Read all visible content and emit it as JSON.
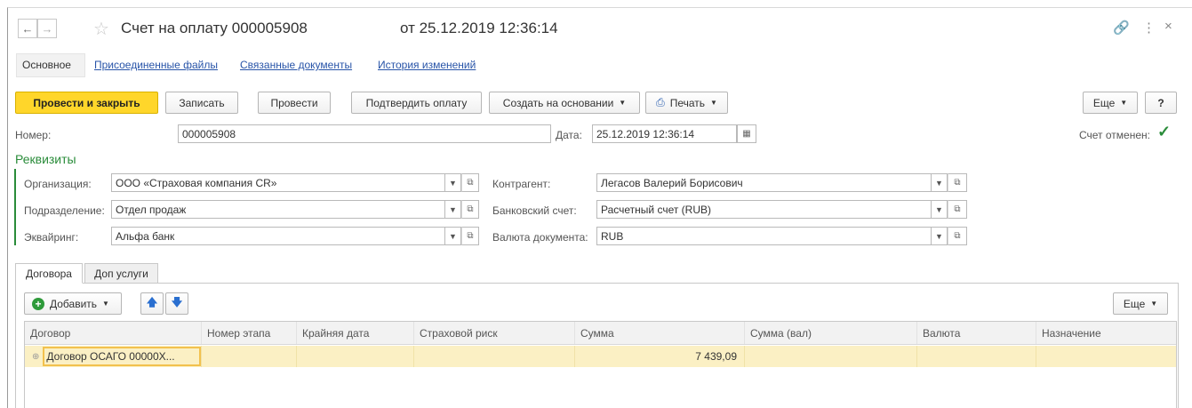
{
  "window": {
    "title": "Счет на оплату 000005908",
    "date_title": "от 25.12.2019 12:36:14"
  },
  "tabs": [
    {
      "label": "Основное"
    },
    {
      "label": "Присоединенные файлы"
    },
    {
      "label": "Связанные документы"
    },
    {
      "label": "История изменений"
    }
  ],
  "toolbar": {
    "post_close": "Провести и закрыть",
    "save": "Записать",
    "post": "Провести",
    "confirm_payment": "Подтвердить оплату",
    "create_based": "Создать на основании",
    "print": "Печать",
    "more": "Еще",
    "help": "?"
  },
  "header": {
    "number_label": "Номер:",
    "number_value": "000005908",
    "date_label": "Дата:",
    "date_value": "25.12.2019 12:36:14",
    "cancelled_label": "Счет отменен:",
    "cancelled_checked": true
  },
  "requisites": {
    "title": "Реквизиты",
    "org_label": "Организация:",
    "org_value": "ООО «Страховая компания CR»",
    "dept_label": "Подразделение:",
    "dept_value": "Отдел продаж",
    "acq_label": "Эквайринг:",
    "acq_value": "Альфа банк",
    "contractor_label": "Контрагент:",
    "contractor_value": "Легасов Валерий Борисович",
    "bank_label": "Банковский счет:",
    "bank_value": "Расчетный счет (RUB)",
    "currency_label": "Валюта документа:",
    "currency_value": "RUB"
  },
  "subtabs": [
    {
      "label": "Договора"
    },
    {
      "label": "Доп услуги"
    }
  ],
  "table_toolbar": {
    "add": "Добавить",
    "more": "Еще"
  },
  "table": {
    "columns": [
      "Договор",
      "Номер этапа",
      "Крайняя дата",
      "Страховой риск",
      "Сумма",
      "Сумма (вал)",
      "Валюта",
      "Назначение"
    ],
    "rows": [
      {
        "contract": "Договор ОСАГО 00000Х...",
        "stage": "",
        "deadline": "",
        "risk": "",
        "sum": "7 439,09",
        "sum_cur": "",
        "currency": "",
        "purpose": ""
      }
    ]
  },
  "colors": {
    "primary_button": "#ffd62a",
    "section_title": "#2a8c3a",
    "link": "#2854a8",
    "selected_row": "#fbf0c4"
  },
  "icons": [
    "back-arrow-icon",
    "forward-arrow-icon",
    "star-icon",
    "link-icon",
    "menu-dots-icon",
    "close-icon",
    "calendar-icon",
    "printer-icon",
    "add-icon",
    "arrow-up-icon",
    "arrow-down-icon",
    "checkmark-icon",
    "expand-icon",
    "open-icon"
  ]
}
